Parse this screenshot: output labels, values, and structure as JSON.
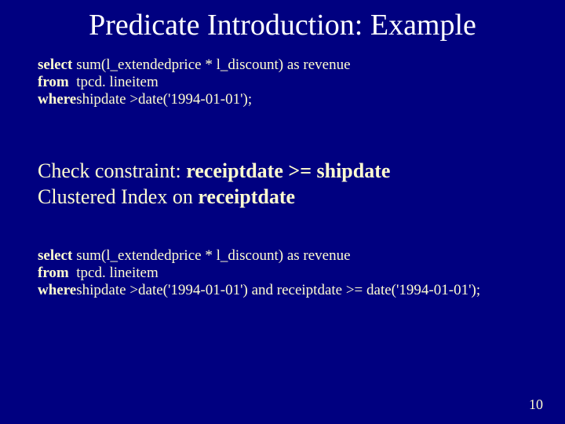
{
  "title": "Predicate Introduction: Example",
  "sql1": {
    "select_kw": "select",
    "select_val": "sum(l_extendedprice * l_discount) as revenue",
    "from_kw": "from",
    "from_val": "tpcd. lineitem",
    "where_kw": "where",
    "where_val": "shipdate >date('1994-01-01');"
  },
  "body": {
    "line1_prefix": "Check constraint: ",
    "line1_bold": "receiptdate >= shipdate",
    "line2_prefix": "Clustered Index on ",
    "line2_bold": "receiptdate"
  },
  "sql2": {
    "select_kw": "select",
    "select_val": "sum(l_extendedprice * l_discount) as revenue",
    "from_kw": "from",
    "from_val": "tpcd. lineitem",
    "where_kw": "where",
    "where_val": "shipdate >date('1994-01-01') and receiptdate >= date('1994-01-01');"
  },
  "page_number": "10"
}
